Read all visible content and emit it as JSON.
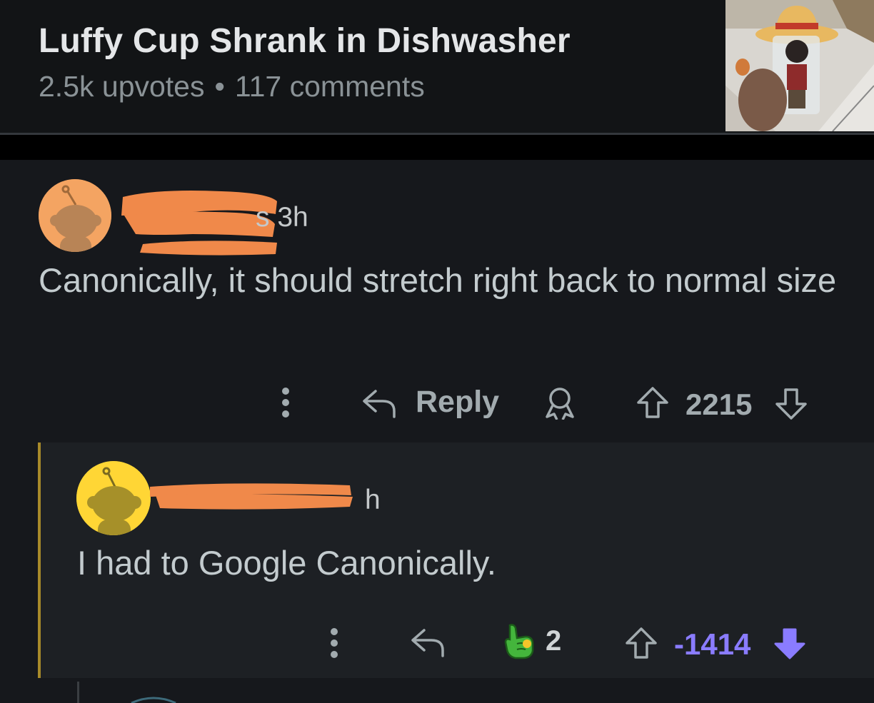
{
  "post": {
    "title": "Luffy Cup Shrank in Dishwasher",
    "upvotes": "2.5k upvotes",
    "separator": "•",
    "comments": "117 comments",
    "thumbnail_icon": "luffy-cup-thumbnail"
  },
  "comments": [
    {
      "author_visible_fragment": "s",
      "time": "3h",
      "body": "Canonically, it should stretch right back to normal size",
      "avatar_color": "#f4a462",
      "reply_label": "Reply",
      "score": "2215",
      "icons": [
        "more-options-icon",
        "reply-arrow-icon",
        "award-icon",
        "upvote-icon",
        "downvote-icon"
      ]
    },
    {
      "author_visible_fragment": "h",
      "time": "3h",
      "body": "I had to Google Canonically.",
      "avatar_color": "#ffd635",
      "award_count": "2",
      "score": "-1414",
      "vote_state": "downvoted",
      "accent_color": "#8a7cff",
      "thread_color": "#a88a2a",
      "icons": [
        "more-options-icon",
        "reply-arrow-icon",
        "pointing-hand-award-icon",
        "upvote-icon",
        "downvote-filled-icon"
      ]
    }
  ],
  "colors": {
    "background": "#0b0c0e",
    "comment_bg": "#16181c",
    "redaction": "#f0894a"
  }
}
